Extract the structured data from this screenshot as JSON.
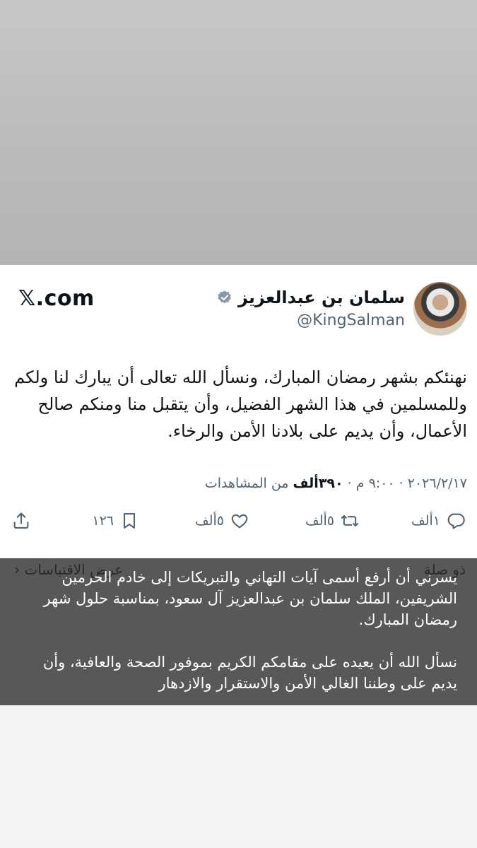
{
  "tweet": {
    "author_name": "سلمان بن عبدالعزيز",
    "handle": "@KingSalman",
    "site_logo": "𝕏.com",
    "text": "نهنئكم بشهر رمضان المبارك، ونسأل الله تعالى أن يبارك لنا ولكم وللمسلمين في هذا الشهر الفضيل، وأن يتقبل منا ومنكم صالح الأعمال، وأن يديم على بلادنا الأمن والرخاء.",
    "date": "٢٠٢٦/٢/١٧",
    "time": "٩:٠٠ م",
    "views_count": "٣٩٠ألف",
    "views_label": "من المشاهدات",
    "replies": "١ألف",
    "reposts": "٥ألف",
    "likes": "٥ألف",
    "bookmarks": "١٢٦",
    "icons": [
      "verified-badge-icon",
      "reply-icon",
      "repost-icon",
      "like-icon",
      "bookmark-icon",
      "share-icon"
    ]
  },
  "underlay": {
    "right_label": "ذو صلة",
    "left_label": "عرض الاقتباسات"
  },
  "overlay": {
    "text": "يسرني أن أرفع أسمى آيات التهاني والتبريكات إلى خادم الحرمين الشريفين، الملك سلمان بن عبدالعزيز آل سعود، بمناسبة حلول شهر رمضان المبارك.\n\nنسأل الله أن يعيده على مقامكم الكريم بموفور الصحة والعافية، وأن يديم على وطننا الغالي الأمن والاستقرار والازدهار"
  },
  "colors": {
    "overlay": "#585858",
    "verified": "#829aab",
    "text": "#0f1419",
    "muted": "#536471"
  }
}
